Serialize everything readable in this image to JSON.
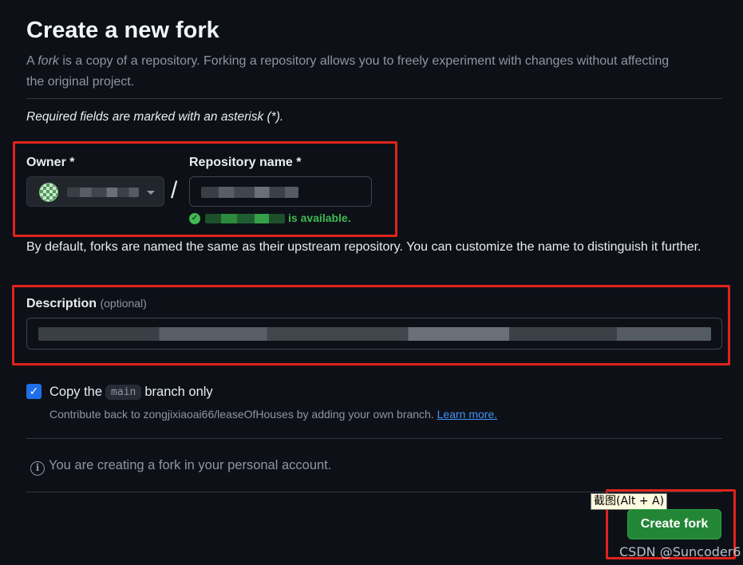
{
  "header": {
    "title": "Create a new fork",
    "intro_before": "A ",
    "intro_em": "fork",
    "intro_after": " is a copy of a repository. Forking a repository allows you to freely experiment with changes without affecting the original project."
  },
  "form": {
    "required_note": "Required fields are marked with an asterisk (*).",
    "owner_label": "Owner *",
    "repo_label": "Repository name *",
    "separator": "/",
    "availability_suffix": "is available.",
    "name_hint": "By default, forks are named the same as their upstream repository. You can customize the name to distinguish it further.",
    "description_label": "Description",
    "description_optional": "(optional)",
    "copy_before": "Copy the",
    "copy_branch": "main",
    "copy_after": "branch only",
    "copy_checked": true,
    "contribute_text": "Contribute back to zongjixiaoai66/leaseOfHouses by adding your own branch.",
    "learn_more": "Learn more.",
    "info_text": "You are creating a fork in your personal account.",
    "submit_label": "Create fork"
  },
  "overlay": {
    "tooltip": "截图(Alt + A)",
    "watermark": "CSDN @Suncoder6"
  },
  "colors": {
    "background": "#0d1117",
    "success": "#3fb950",
    "primary_button": "#238636",
    "highlight_box": "#e0231c",
    "link": "#4493f8"
  }
}
